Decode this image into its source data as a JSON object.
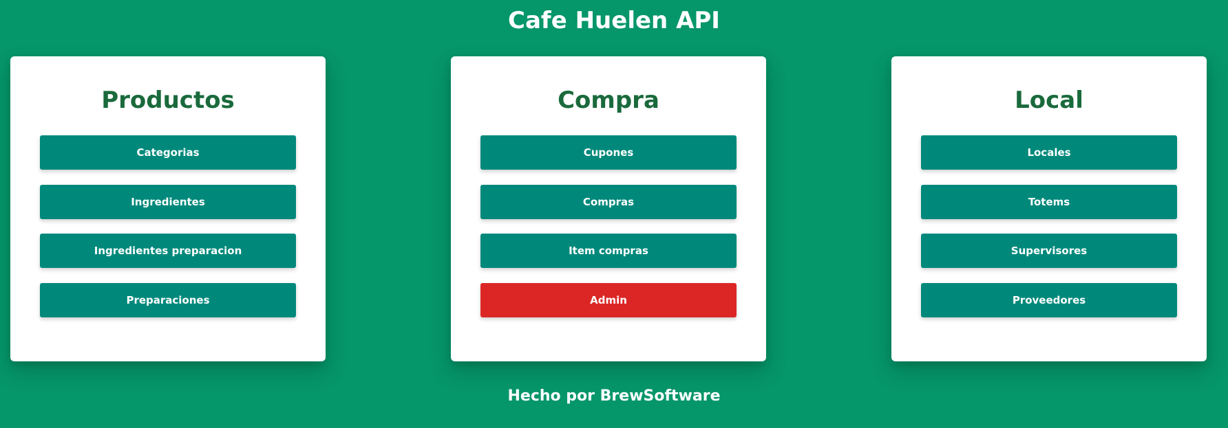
{
  "header": {
    "title": "Cafe Huelen API"
  },
  "colors": {
    "background": "#059669",
    "card": "#ffffff",
    "card_title": "#1a6a3c",
    "button": "#00897b",
    "button_danger": "#dc2626"
  },
  "cards": [
    {
      "title": "Productos",
      "buttons": [
        "Categorias",
        "Ingredientes",
        "Ingredientes preparacion",
        "Preparaciones"
      ]
    },
    {
      "title": "Compra",
      "buttons": [
        "Cupones",
        "Compras",
        "Item compras",
        "Admin"
      ]
    },
    {
      "title": "Local",
      "buttons": [
        "Locales",
        "Totems",
        "Supervisores",
        "Proveedores"
      ]
    }
  ],
  "footer": {
    "text": "Hecho por BrewSoftware"
  }
}
